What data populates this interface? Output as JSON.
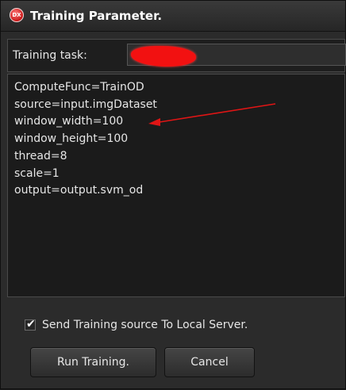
{
  "window": {
    "title": "Training Parameter.",
    "icon_label": "DX"
  },
  "training_task": {
    "label": "Training task:",
    "value": "",
    "redacted": true
  },
  "parameters": [
    "ComputeFunc=TrainOD",
    "source=input.imgDataset",
    "window_width=100",
    "window_height=100",
    "thread=8",
    "scale=1",
    "output=output.svm_od"
  ],
  "options": {
    "send_to_local_server": {
      "label": "Send Training source To Local Server.",
      "checked": true
    }
  },
  "buttons": {
    "run": "Run Training.",
    "cancel": "Cancel"
  },
  "colors": {
    "background": "#2b2b2b",
    "text": "#e6e6e6",
    "annotation_arrow": "#e01515",
    "redaction": "#f21111",
    "app_icon": "#d41e1e"
  },
  "icons": [
    "app-icon",
    "checkmark-icon"
  ]
}
